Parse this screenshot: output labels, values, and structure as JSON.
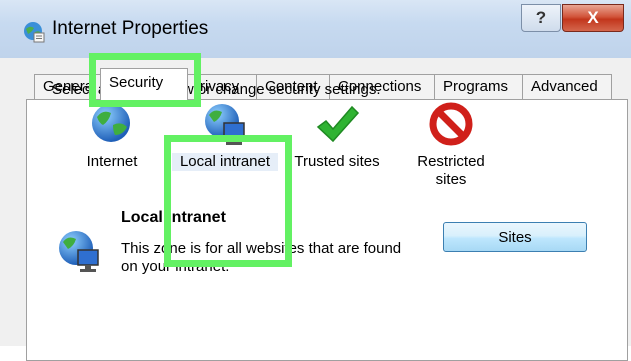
{
  "window": {
    "title": "Internet Properties",
    "help_label": "?",
    "close_label": "X"
  },
  "tabs": [
    {
      "label": "Genera"
    },
    {
      "label": "Security"
    },
    {
      "label": "rivacy"
    },
    {
      "label": "Content"
    },
    {
      "label": "Connections"
    },
    {
      "label": "Programs"
    },
    {
      "label": "Advanced"
    }
  ],
  "security": {
    "zone_prompt": "Select a zone to view or change security settings.",
    "zones": [
      {
        "label": "Internet",
        "icon": "globe-icon"
      },
      {
        "label": "Local intranet",
        "icon": "intranet-icon"
      },
      {
        "label": "Trusted sites",
        "icon": "checkmark-icon"
      },
      {
        "label": "Restricted sites",
        "icon": "prohibited-icon"
      }
    ],
    "selected_zone": {
      "title": "Local intranet",
      "description": "This zone is for all websites that are found on your intranet."
    },
    "sites_button": "Sites"
  },
  "colors": {
    "highlight": "#63f163",
    "close_button": "#c2361c",
    "checkmark": "#2fb332",
    "prohibited": "#d0201a"
  }
}
